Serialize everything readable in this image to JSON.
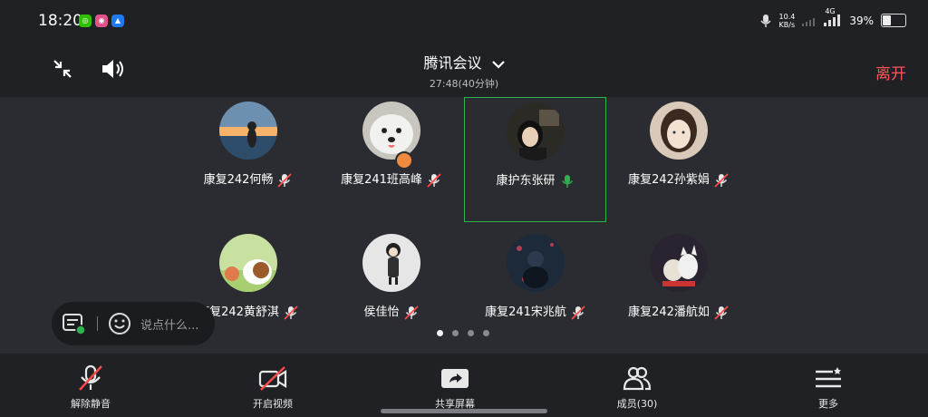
{
  "status_bar": {
    "time": "18:20",
    "app_icons": [
      {
        "icon": "wechat-icon",
        "color": "#2dc100",
        "glyph": "◎"
      },
      {
        "icon": "soul-app-icon",
        "color": "#e0528a",
        "glyph": "◉"
      },
      {
        "icon": "feishu-icon",
        "color": "#1f7af0",
        "glyph": "▲"
      }
    ],
    "net_speed": "10.4",
    "net_unit": "KB/s",
    "network": "4G",
    "battery": "39%",
    "battery_level": 0.39
  },
  "header": {
    "title": "腾讯会议",
    "duration": "27:48(40分钟)",
    "leave_label": "离开"
  },
  "participants": [
    {
      "name": "康复242何畅",
      "muted": true,
      "avatar_colors": [
        "#f5b36a",
        "#2e4d6b"
      ],
      "avatar": "sunset"
    },
    {
      "name": "康复241班高峰",
      "muted": true,
      "avatar_colors": [
        "#f1f1ef",
        "#6a5a40"
      ],
      "avatar": "dog",
      "host_badge": true
    },
    {
      "name": "康护东张研",
      "muted": false,
      "speaking": true,
      "avatar_colors": [
        "#2c2a25",
        "#7a6a55"
      ],
      "avatar": "girl"
    },
    {
      "name": "康复242孙紫娟",
      "muted": true,
      "avatar_colors": [
        "#d9c9b8",
        "#3a2a20"
      ],
      "avatar": "girl2"
    },
    {
      "name": "康复242黄舒淇",
      "muted": true,
      "avatar_colors": [
        "#c8e0a0",
        "#e07a4a"
      ],
      "avatar": "cartoon"
    },
    {
      "name": "侯佳怡",
      "muted": true,
      "avatar_colors": [
        "#e6e6e6",
        "#303030"
      ],
      "avatar": "doll"
    },
    {
      "name": "康复241宋兆航",
      "muted": true,
      "avatar_colors": [
        "#1d2a3a",
        "#b04050"
      ],
      "avatar": "night"
    },
    {
      "name": "康复242潘航如",
      "muted": true,
      "avatar_colors": [
        "#2a2430",
        "#f0f0f0"
      ],
      "avatar": "cats"
    }
  ],
  "chat": {
    "placeholder": "说点什么..."
  },
  "pager": {
    "pages": 4,
    "current": 0
  },
  "toolbar": [
    {
      "label": "解除静音",
      "icon": "mic-muted-icon"
    },
    {
      "label": "开启视频",
      "icon": "video-off-icon"
    },
    {
      "label": "共享屏幕",
      "icon": "share-screen-icon"
    },
    {
      "label": "成员(30)",
      "icon": "members-icon"
    },
    {
      "label": "更多",
      "icon": "more-menu-icon"
    }
  ],
  "colors": {
    "leave": "#ff5656",
    "speaking": "#2fb14f",
    "muted": "#ff4a4a"
  }
}
